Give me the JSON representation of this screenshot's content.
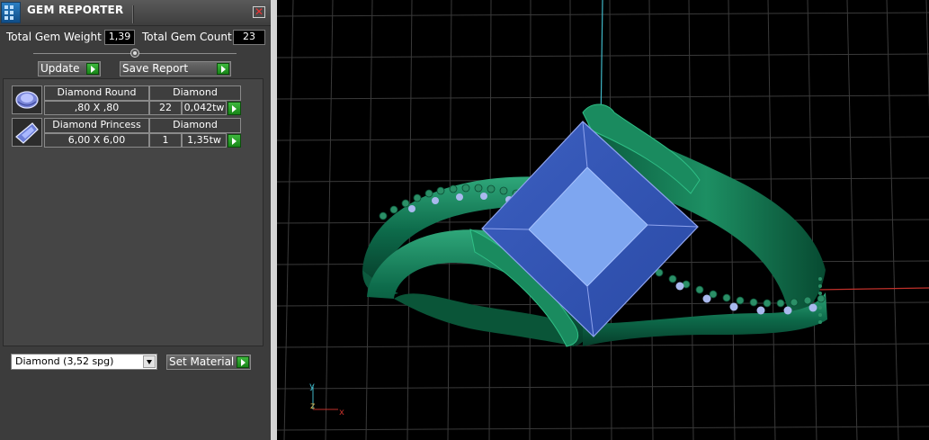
{
  "window": {
    "title": "GEM REPORTER",
    "close_glyph": "✕"
  },
  "summary": {
    "total_weight_label": "Total Gem Weight",
    "total_weight_value": "1,39",
    "total_count_label": "Total Gem Count",
    "total_count_value": "23"
  },
  "actions": {
    "update_label": "Update",
    "save_report_label": "Save Report"
  },
  "gems": [
    {
      "shape": "Diamond Round",
      "material": "Diamond",
      "size": ",80 X ,80",
      "count": "22",
      "weight": "0,042tw",
      "icon": "round-gem-icon"
    },
    {
      "shape": "Diamond Princess",
      "material": "Diamond",
      "size": "6,00 X 6,00",
      "count": "1",
      "weight": "1,35tw",
      "icon": "princess-gem-icon"
    }
  ],
  "material_selector": {
    "selected": "Diamond     (3,52 spg)",
    "set_material_label": "Set Material"
  },
  "viewport": {
    "axis_labels": {
      "y": "y",
      "z": "z",
      "x": "x"
    },
    "colors": {
      "background": "#000000",
      "grid": "#3a3a3a",
      "metal": "#0e6e4e",
      "gem": "#5b7fd6",
      "x_axis": "#c0302a",
      "y_axis": "#3fb6c6"
    }
  },
  "colors": {
    "panel_bg": "#3c3c3c",
    "accent_green": "#2ea52e",
    "field_bg": "#000000"
  }
}
